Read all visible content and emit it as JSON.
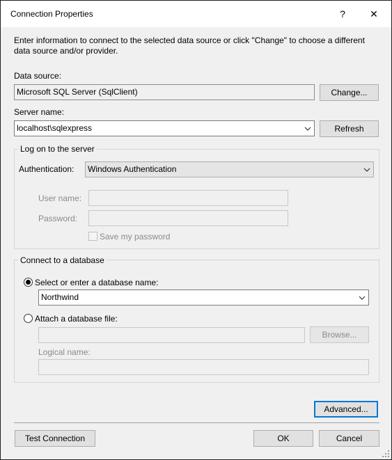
{
  "window": {
    "title": "Connection Properties",
    "help_label": "?",
    "close_label": "✕"
  },
  "intro_text": "Enter information to connect to the selected data source or click \"Change\" to choose a different data source and/or provider.",
  "data_source": {
    "label": "Data source:",
    "value": "Microsoft SQL Server (SqlClient)",
    "change_label": "Change..."
  },
  "server": {
    "label": "Server name:",
    "value": "localhost\\sqlexpress",
    "refresh_label": "Refresh"
  },
  "logon": {
    "group_title": "Log on to the server",
    "auth_label": "Authentication:",
    "auth_value": "Windows Authentication",
    "username_label": "User name:",
    "username_value": "",
    "password_label": "Password:",
    "password_value": "",
    "save_password_label": "Save my password",
    "save_password_checked": false
  },
  "database": {
    "group_title": "Connect to a database",
    "select_option_label": "Select or enter a database name:",
    "select_option_selected": true,
    "database_name": "Northwind",
    "attach_option_label": "Attach a database file:",
    "attach_option_selected": false,
    "attach_file_value": "",
    "browse_label": "Browse...",
    "logical_name_label": "Logical name:",
    "logical_name_value": ""
  },
  "advanced_label": "Advanced...",
  "footer": {
    "test_connection_label": "Test Connection",
    "ok_label": "OK",
    "cancel_label": "Cancel"
  },
  "icons": {
    "dropdown": "chevron-down-icon",
    "resize": "resize-grip-icon"
  },
  "colors": {
    "accent": "#0078d7",
    "dialog_bg": "#f0f0f0"
  }
}
